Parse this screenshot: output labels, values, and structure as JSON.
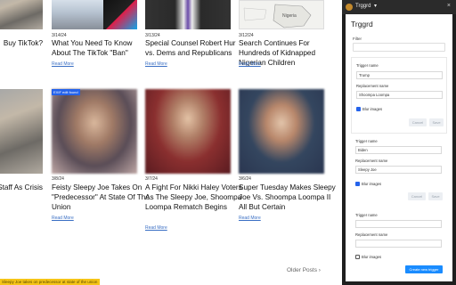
{
  "blog": {
    "row0": [
      {
        "title": "Buy TikTok?",
        "date": "",
        "more": ""
      },
      {
        "title": "What You Need To Know About The TikTok \"Ban\"",
        "date": "3/14/24",
        "more": "Read More"
      },
      {
        "title": "Special Counsel Robert Hur vs. Dems and Republicans",
        "date": "3/13/24",
        "more": "Read More"
      },
      {
        "title": "Search Continues For Hundreds of Kidnapped Nigerian Children",
        "date": "3/12/24",
        "more": "Read More"
      }
    ],
    "row1": [
      {
        "title": "mbassy Staff As Crisis",
        "date": "",
        "more": ""
      },
      {
        "title": "Feisty Sleepy Joe Takes On \"Predecessor\" At State Of The Union",
        "date": "3/8/24",
        "more": "Read More",
        "badge": "EXIF edit found"
      },
      {
        "title": "A Fight For Nikki Haley Voters As The Sleepy Joe, Shoompa Loompa Rematch Begins",
        "date": "3/7/24",
        "more": "Read More"
      },
      {
        "title": "Super Tuesday Makes Sleepy Joe Vs. Shoompa Loompa II All But Certain",
        "date": "3/6/24",
        "more": "Read More"
      }
    ],
    "map_label": "Nigeria",
    "older_posts": "Older Posts",
    "older_posts_icon": "chevron-right-icon",
    "bottom_banner": "Sleepy Joe takes on predecessor at state of the union"
  },
  "panel": {
    "extension_name": "Trggrd",
    "caret": "▾",
    "close": "×",
    "app_title": "Trggrd",
    "filter_label": "Filter",
    "filter_value": "",
    "triggers": [
      {
        "trigger_label": "Trigger name",
        "trigger_value": "Trump",
        "replacement_label": "Replacement name",
        "replacement_value": "Shoompa Loompa",
        "blur_label": "Blur images",
        "blur_checked": true,
        "cancel": "Cancel",
        "save": "Save"
      },
      {
        "trigger_label": "Trigger name",
        "trigger_value": "Biden",
        "replacement_label": "Replacement name",
        "replacement_value": "Sleepy Joe",
        "blur_label": "Blur images",
        "blur_checked": true,
        "cancel": "Cancel",
        "save": "Save"
      }
    ],
    "new_trigger": {
      "trigger_label": "Trigger name",
      "trigger_value": "",
      "replacement_label": "Replacement name",
      "replacement_value": "",
      "blur_label": "Blur images",
      "blur_checked": false,
      "create": "Create new trigger"
    },
    "colors": {
      "accent": "#1a8cff",
      "panel_bg": "#1f1f1f",
      "checkbox": "#2563eb"
    }
  }
}
